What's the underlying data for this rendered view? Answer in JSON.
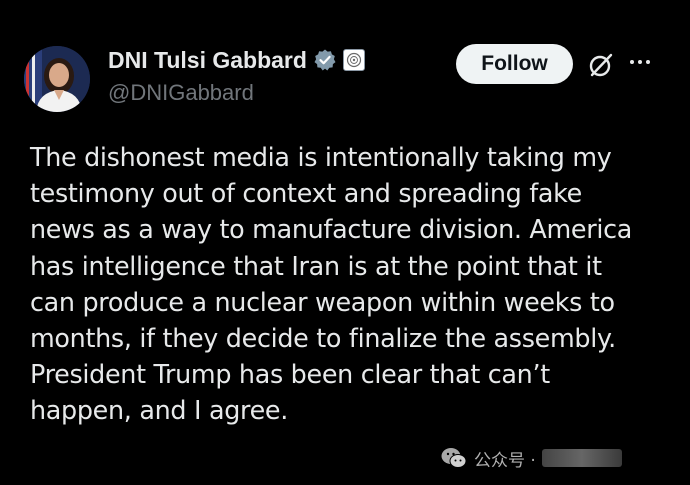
{
  "tweet": {
    "author": {
      "display_name": "DNI Tulsi Gabbard",
      "handle": "@DNIGabbard",
      "verified_color": "#829aab"
    },
    "follow_label": "Follow",
    "text_lines": [
      "The dishonest media is intentionally taking my",
      "testimony out of context and spreading fake",
      "news as a way to manufacture division. America",
      "has intelligence that Iran is at the point that it",
      "can produce a nuclear weapon within weeks to",
      "months, if they decide to finalize the assembly.",
      "President Trump has been clear that can’t",
      "happen, and I agree."
    ]
  },
  "watermark": {
    "label": "公众号 ·"
  },
  "icons": {
    "verified": "verified-badge-icon",
    "affiliate": "government-seal-icon",
    "grok": "grok-icon",
    "more": "more-options-icon",
    "wechat": "wechat-icon"
  },
  "colors": {
    "background": "#000000",
    "text": "#e7e9ea",
    "secondary_text": "#71767b",
    "follow_bg": "#eff3f4",
    "follow_text": "#0f1419"
  }
}
